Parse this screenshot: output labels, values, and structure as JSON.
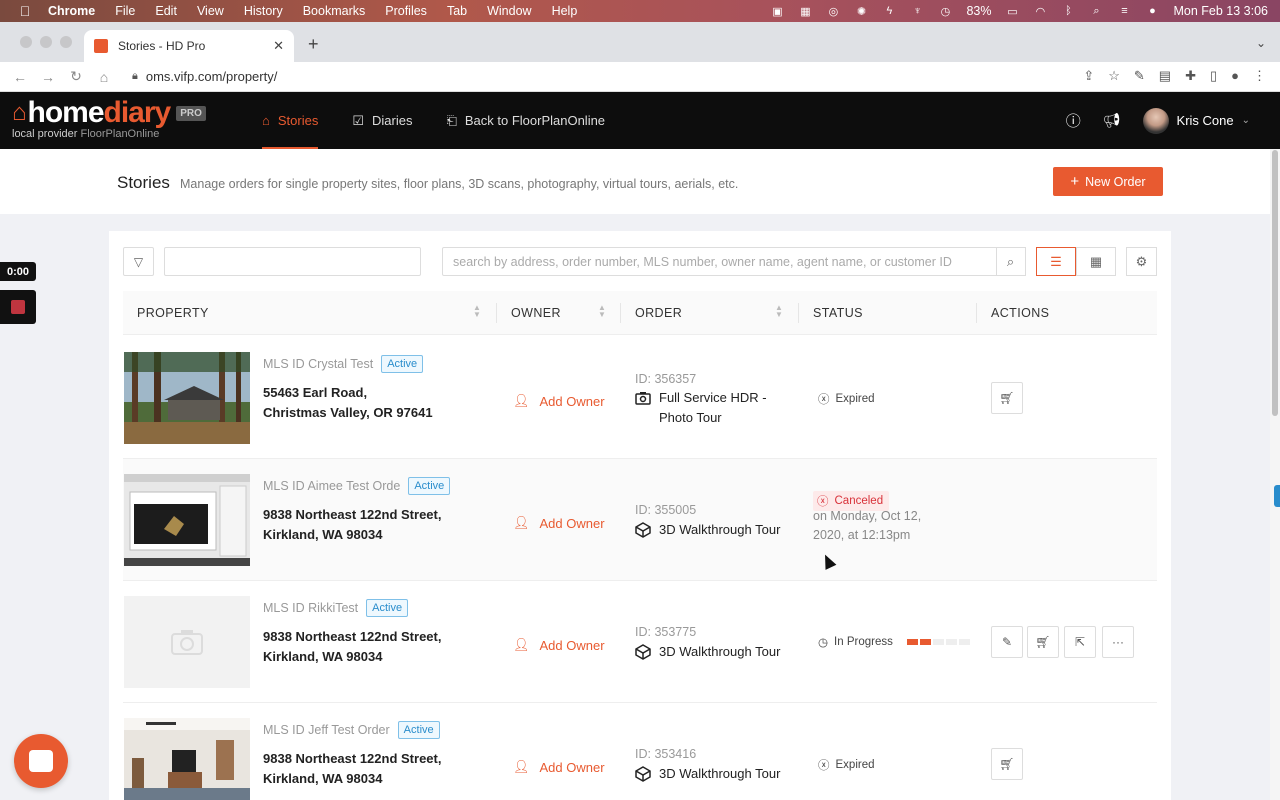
{
  "menubar": {
    "app": "Chrome",
    "items": [
      "File",
      "Edit",
      "View",
      "History",
      "Bookmarks",
      "Profiles",
      "Tab",
      "Window",
      "Help"
    ],
    "battery": "83%",
    "clock": "Mon Feb 13  3:06"
  },
  "browser": {
    "tab_title": "Stories - HD Pro",
    "url": "oms.vifp.com/property/"
  },
  "app": {
    "brand_home": "home",
    "brand_diary": "diary",
    "pro": "PRO",
    "local_provider": "local provider",
    "provider_name": "FloorPlanOnline",
    "nav": [
      {
        "label": "Stories",
        "icon": "home-icon",
        "active": true
      },
      {
        "label": "Diaries",
        "icon": "checkbox-icon",
        "active": false
      },
      {
        "label": "Back to FloorPlanOnline",
        "icon": "exit-icon",
        "active": false
      }
    ],
    "user_name": "Kris Cone"
  },
  "page": {
    "title": "Stories",
    "subtitle": "Manage orders for single property sites, floor plans, 3D scans, photography, virtual tours, aerials, etc.",
    "new_order": "New Order",
    "search_placeholder": "search by address, order number, MLS number, owner name, agent name, or customer ID"
  },
  "table": {
    "headers": [
      "PROPERTY",
      "OWNER",
      "ORDER",
      "STATUS",
      "ACTIONS"
    ],
    "rows": [
      {
        "mls": "MLS ID Crystal Test",
        "badge": "Active",
        "addr1": "55463 Earl Road,",
        "addr2": "Christmas Valley, OR 97641",
        "owner": "Add Owner",
        "order_id": "ID: 356357",
        "order_line1": "Full Service HDR -",
        "order_line2": "Photo Tour",
        "order_icon": "camera-icon",
        "status": "Expired",
        "actions": [
          "cart-icon"
        ]
      },
      {
        "mls": "MLS ID Aimee Test Orde",
        "badge": "Active",
        "addr1": "9838 Northeast 122nd Street,",
        "addr2": "Kirkland, WA 98034",
        "owner": "Add Owner",
        "order_id": "ID: 355005",
        "order_line1": "3D Walkthrough Tour",
        "order_icon": "cube-icon",
        "status": "Canceled",
        "status_date_1": "on Monday, Oct 12,",
        "status_date_2": "2020, at 12:13pm",
        "actions": []
      },
      {
        "mls": "MLS ID RikkiTest",
        "badge": "Active",
        "addr1": "9838 Northeast 122nd Street,",
        "addr2": "Kirkland, WA 98034",
        "owner": "Add Owner",
        "order_id": "ID: 353775",
        "order_line1": "3D Walkthrough Tour",
        "order_icon": "cube-icon",
        "status": "In Progress",
        "progress": 0.4,
        "actions": [
          "edit-icon",
          "cart-icon",
          "export-icon",
          "more-icon"
        ],
        "more_glyph": "···"
      },
      {
        "mls": "MLS ID Jeff Test Order",
        "badge": "Active",
        "addr1": "9838 Northeast 122nd Street,",
        "addr2": "Kirkland, WA 98034",
        "owner": "Add Owner",
        "order_id": "ID: 353416",
        "order_line1": "3D Walkthrough Tour",
        "order_icon": "cube-icon",
        "status": "Expired",
        "actions": [
          "cart-icon"
        ]
      }
    ]
  },
  "overlay": {
    "timer": "0:00"
  },
  "colors": {
    "accent": "#e85a30",
    "header_bg": "#0d0d0d",
    "badge_blue": "#2a8dcc",
    "canceled_red": "#d8323a"
  }
}
